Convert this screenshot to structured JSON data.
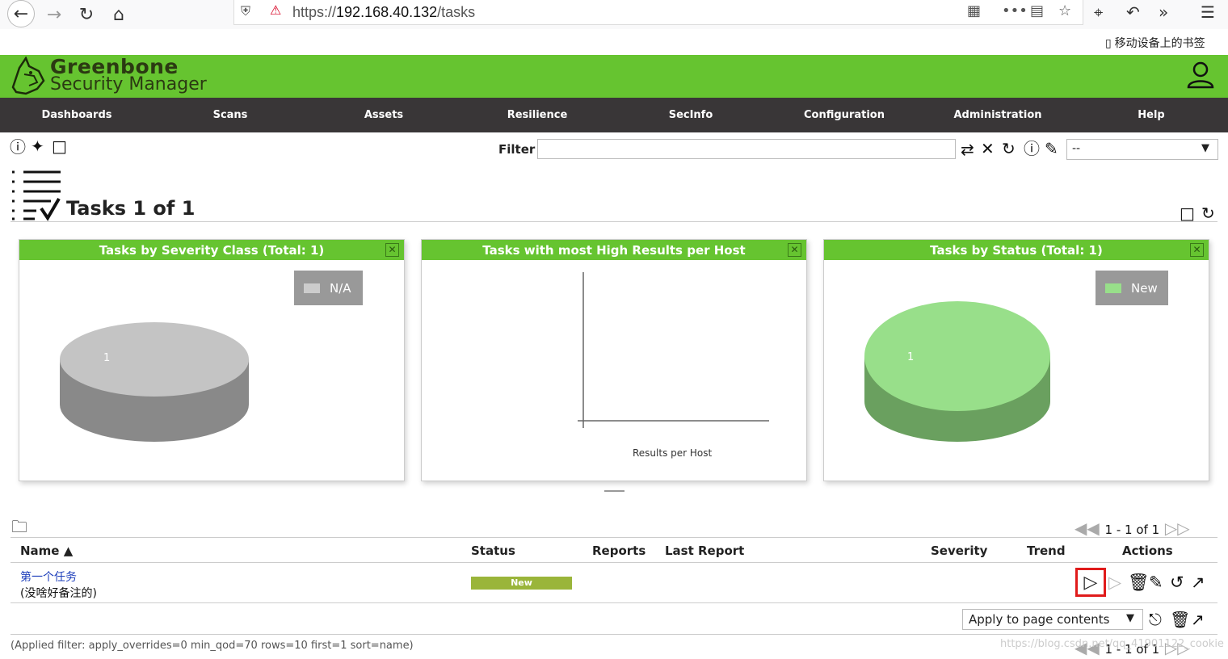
{
  "browser": {
    "url_prefix": "https://",
    "url_host": "192.168.40.132",
    "url_path": "/tasks",
    "bookmarks_label": "移动设备上的书签"
  },
  "app": {
    "brand_line1": "Greenbone",
    "brand_line2": "Security Manager",
    "accent_color": "#66c430",
    "nav": [
      "Dashboards",
      "Scans",
      "Assets",
      "Resilience",
      "SecInfo",
      "Configuration",
      "Administration",
      "Help"
    ]
  },
  "toolbar": {
    "filter_label": "Filter",
    "filter_value": "",
    "filter_select_value": "--"
  },
  "page": {
    "title": "Tasks 1 of 1"
  },
  "dashboard": {
    "panels": [
      {
        "title": "Tasks by Severity Class (Total: 1)",
        "legend": "N/A",
        "slice_label": "1",
        "color": "#c4c4c4"
      },
      {
        "title": "Tasks with most High Results per Host",
        "axis_label": "Results per Host"
      },
      {
        "title": "Tasks by Status (Total: 1)",
        "legend": "New",
        "slice_label": "1",
        "color": "#98df8a"
      }
    ]
  },
  "table": {
    "pager_top": "1 - 1 of 1",
    "headers": {
      "name": "Name ▲",
      "status": "Status",
      "reports": "Reports",
      "last_report": "Last Report",
      "severity": "Severity",
      "trend": "Trend",
      "actions": "Actions"
    },
    "rows": [
      {
        "name": "第一个任务",
        "comment": "(没啥好备注的)",
        "status": "New"
      }
    ],
    "bulk_action": "Apply to page contents",
    "applied_filter": "(Applied filter: apply_overrides=0 min_qod=70 rows=10 first=1 sort=name)",
    "pager_bottom": "1 - 1 of 1"
  },
  "watermark": "https://blog.csdn.net/qq_41901122_cookie"
}
